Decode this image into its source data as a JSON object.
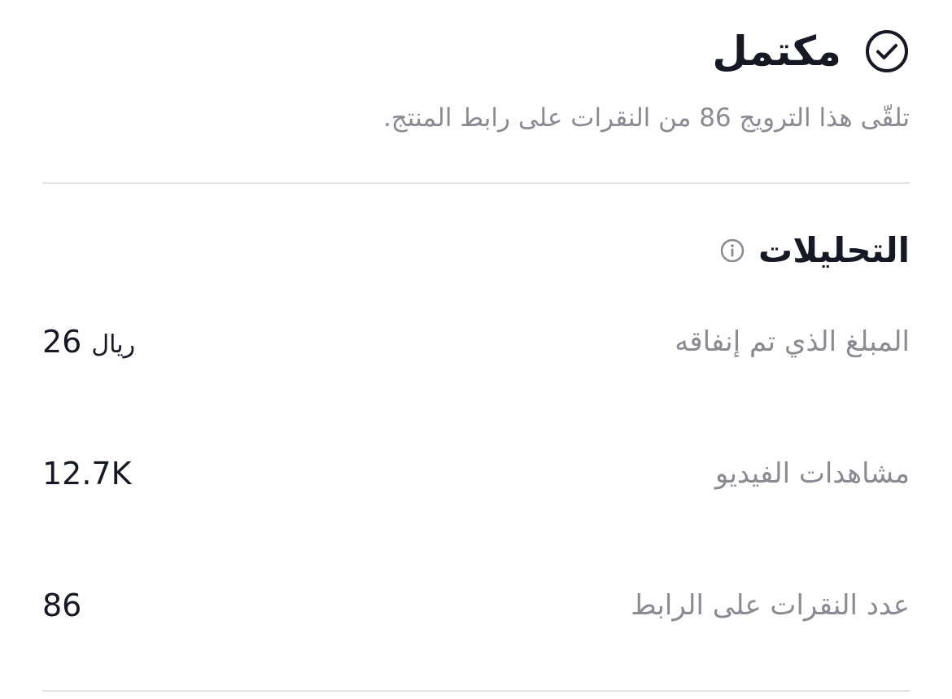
{
  "status": {
    "title": "مكتمل",
    "description": "تلقّى هذا الترويج 86 من النقرات على رابط المنتج.",
    "icon": "check-circle-icon"
  },
  "analytics": {
    "title": "التحليلات",
    "info_icon": "info-icon",
    "metrics": [
      {
        "label": "المبلغ الذي تم إنفاقه",
        "value": "26",
        "unit": "ريال"
      },
      {
        "label": "مشاهدات الفيديو",
        "value": "12.7K"
      },
      {
        "label": "عدد النقرات على الرابط",
        "value": "86"
      }
    ]
  },
  "colors": {
    "text_primary": "#161823",
    "text_secondary": "#8a8b91",
    "divider": "#e3e3e4"
  }
}
